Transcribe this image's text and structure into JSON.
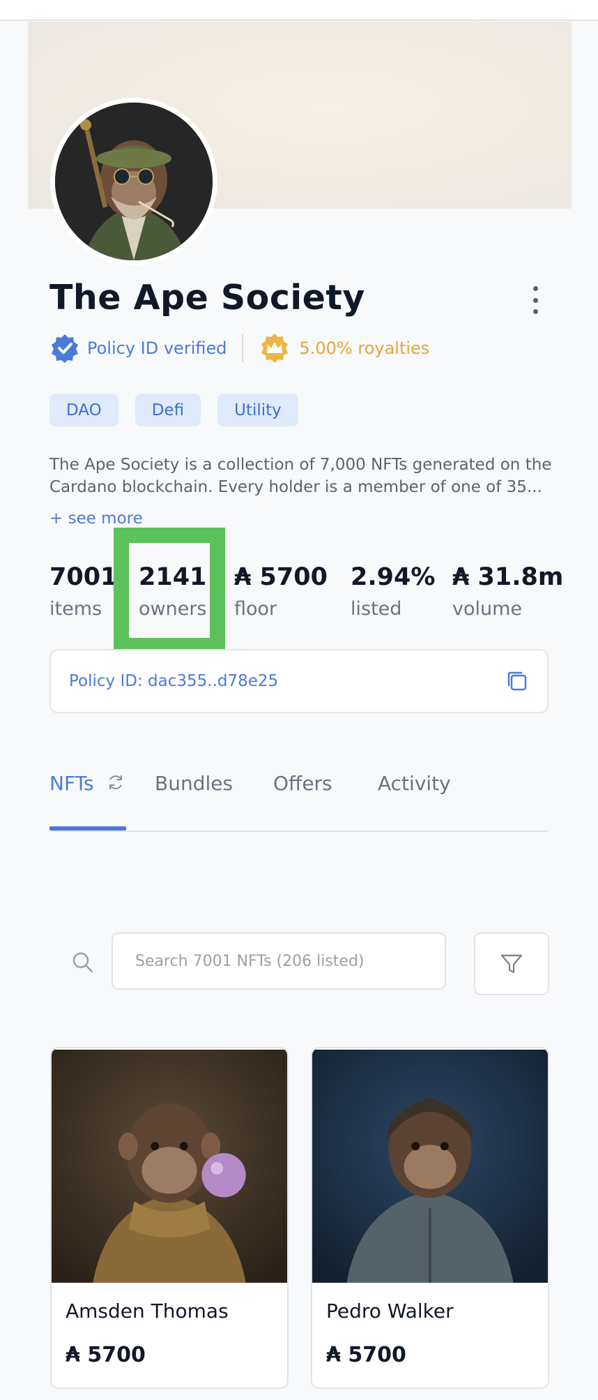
{
  "collection": {
    "title": "The Ape Society",
    "verified_label": "Policy ID verified",
    "royalties_label": "5.00% royalties",
    "tags": [
      "DAO",
      "Defi",
      "Utility"
    ],
    "description": "The Ape Society is a collection of 7,000 NFTs generated on the Cardano blockchain. Every holder is a member of one of 35...",
    "see_more": "+ see more"
  },
  "stats": [
    {
      "value": "7001",
      "label": "items"
    },
    {
      "value": "2141",
      "label": "owners"
    },
    {
      "value": "₳ 5700",
      "label": "floor"
    },
    {
      "value": "2.94%",
      "label": "listed"
    },
    {
      "value": "₳ 31.8m",
      "label": "volume"
    }
  ],
  "policy": {
    "text": "Policy ID: dac355..d78e25"
  },
  "tabs": [
    {
      "label": "NFTs",
      "active": true
    },
    {
      "label": "Bundles",
      "active": false
    },
    {
      "label": "Offers",
      "active": false
    },
    {
      "label": "Activity",
      "active": false
    }
  ],
  "search": {
    "placeholder": "Search 7001 NFTs (206 listed)"
  },
  "nfts": [
    {
      "name": "Amsden Thomas",
      "price": "₳ 5700"
    },
    {
      "name": "Pedro Walker",
      "price": "₳ 5700"
    }
  ],
  "colors": {
    "accent": "#4a7bd8",
    "royalty": "#e2a63b",
    "highlight": "#5cc35c",
    "tag_bg": "#dfeafb"
  },
  "icons": {
    "verified": "verified-badge-icon",
    "royalty": "crown-icon",
    "menu": "kebab-menu-icon",
    "copy": "copy-icon",
    "refresh": "refresh-icon",
    "search": "search-icon",
    "filter": "filter-icon"
  }
}
